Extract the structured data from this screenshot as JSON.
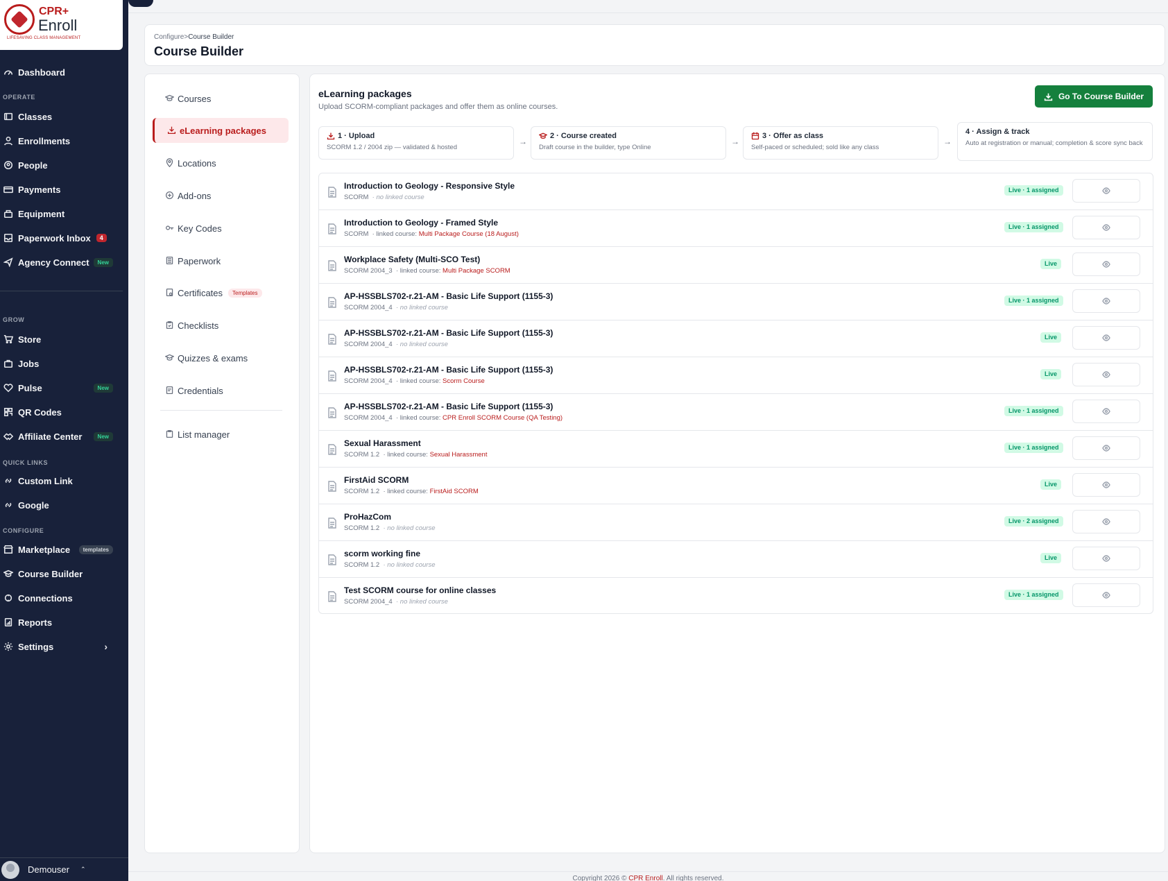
{
  "logo": {
    "line1": "CPR+",
    "line2": "Enroll",
    "tagline": "LIFESAVING CLASS MANAGEMENT"
  },
  "sidebar": {
    "dashboard": "Dashboard",
    "sections": {
      "operate": "OPERATE",
      "grow": "GROW",
      "quick_links": "QUICK LINKS",
      "configure": "CONFIGURE"
    },
    "operate": [
      {
        "label": "Classes",
        "icon": "book-icon"
      },
      {
        "label": "Enrollments",
        "icon": "user-icon"
      },
      {
        "label": "People",
        "icon": "people-icon"
      },
      {
        "label": "Payments",
        "icon": "payments-icon"
      },
      {
        "label": "Equipment",
        "icon": "equipment-icon"
      },
      {
        "label": "Paperwork Inbox",
        "icon": "inbox-icon",
        "badge": "4"
      },
      {
        "label": "Agency Connect",
        "icon": "send-icon",
        "badge": "New"
      }
    ],
    "grow": [
      {
        "label": "Store",
        "icon": "cart-icon"
      },
      {
        "label": "Jobs",
        "icon": "briefcase-icon"
      },
      {
        "label": "Pulse",
        "icon": "heart-icon",
        "badge": "New"
      },
      {
        "label": "QR Codes",
        "icon": "qr-icon"
      },
      {
        "label": "Affiliate Center",
        "icon": "handshake-icon",
        "badge": "New"
      }
    ],
    "quick_links": [
      {
        "label": "Custom Link",
        "icon": "link-icon"
      },
      {
        "label": "Google",
        "icon": "link-icon"
      }
    ],
    "configure": [
      {
        "label": "Marketplace",
        "icon": "store-icon",
        "badge": "templates"
      },
      {
        "label": "Course Builder",
        "icon": "graduation-icon"
      },
      {
        "label": "Connections",
        "icon": "connections-icon"
      },
      {
        "label": "Reports",
        "icon": "reports-icon"
      },
      {
        "label": "Settings",
        "icon": "gear-icon"
      }
    ],
    "user": {
      "name": "Demouser"
    }
  },
  "breadcrumb": {
    "parent": "Configure",
    "separator": ">",
    "current": "Course Builder"
  },
  "page_title": "Course Builder",
  "left_nav": [
    {
      "label": "Courses",
      "icon": "graduation-icon"
    },
    {
      "label": "eLearning packages",
      "icon": "download-icon",
      "active": true
    },
    {
      "label": "Locations",
      "icon": "pin-icon"
    },
    {
      "label": "Add-ons",
      "icon": "addon-icon"
    },
    {
      "label": "Key Codes",
      "icon": "key-icon"
    },
    {
      "label": "Paperwork",
      "icon": "paperwork-icon"
    },
    {
      "label": "Certificates",
      "icon": "certificate-icon",
      "badge": "Templates"
    },
    {
      "label": "Checklists",
      "icon": "checklist-icon"
    },
    {
      "label": "Quizzes & exams",
      "icon": "graduation-icon"
    },
    {
      "label": "Credentials",
      "icon": "credential-icon"
    },
    {
      "label": "List manager",
      "icon": "clipboard-icon"
    }
  ],
  "main": {
    "title": "eLearning packages",
    "subtitle": "Upload SCORM-compliant packages and offer them as online courses.",
    "go_button": "Go To Course Builder",
    "steps": [
      {
        "title": "1 · Upload",
        "desc": "SCORM 1.2 / 2004 zip — validated & hosted"
      },
      {
        "title": "2 · Course created",
        "desc": "Draft course in the builder, type Online"
      },
      {
        "title": "3 · Offer as class",
        "desc": "Self-paced or scheduled; sold like any class"
      },
      {
        "title": "4 · Assign & track",
        "desc": "Auto at registration or manual; completion & score sync back"
      }
    ],
    "arrow": "→",
    "linked_prefix": "· linked course: ",
    "no_link": "· no linked course",
    "packages": [
      {
        "title": "Introduction to Geology - Responsive Style",
        "version": "SCORM",
        "course": null,
        "status": "Live · 1 assigned"
      },
      {
        "title": "Introduction to Geology - Framed Style",
        "version": "SCORM",
        "course": "Multi Package Course (18 August)",
        "status": "Live · 1 assigned"
      },
      {
        "title": "Workplace Safety (Multi-SCO Test)",
        "version": "SCORM 2004_3",
        "course": "Multi Package SCORM",
        "status": "Live"
      },
      {
        "title": "AP-HSSBLS702-r.21-AM - Basic Life Support (1155-3)",
        "version": "SCORM 2004_4",
        "course": null,
        "status": "Live · 1 assigned"
      },
      {
        "title": "AP-HSSBLS702-r.21-AM - Basic Life Support (1155-3)",
        "version": "SCORM 2004_4",
        "course": null,
        "status": "Live"
      },
      {
        "title": "AP-HSSBLS702-r.21-AM - Basic Life Support (1155-3)",
        "version": "SCORM 2004_4",
        "course": "Scorm Course",
        "status": "Live"
      },
      {
        "title": "AP-HSSBLS702-r.21-AM - Basic Life Support (1155-3)",
        "version": "SCORM 2004_4",
        "course": "CPR Enroll SCORM Course (QA Testing)",
        "status": "Live · 1 assigned"
      },
      {
        "title": "Sexual Harassment",
        "version": "SCORM 1.2",
        "course": "Sexual Harassment",
        "status": "Live · 1 assigned"
      },
      {
        "title": "FirstAid SCORM",
        "version": "SCORM 1.2",
        "course": "FirstAid SCORM",
        "status": "Live"
      },
      {
        "title": "ProHazCom",
        "version": "SCORM 1.2",
        "course": null,
        "status": "Live · 2 assigned"
      },
      {
        "title": "scorm working fine",
        "version": "SCORM 1.2",
        "course": null,
        "status": "Live"
      },
      {
        "title": "Test SCORM course for online classes",
        "version": "SCORM 2004_4",
        "course": null,
        "status": "Live · 1 assigned"
      }
    ]
  },
  "footer": {
    "prefix": "Copyright 2026 © ",
    "brand": "CPR Enroll",
    "suffix": ". All rights reserved."
  },
  "colors": {
    "sidebar": "#18213a",
    "accent": "#b91c1c",
    "success": "#15803d",
    "status_bg": "#d1fae5"
  }
}
